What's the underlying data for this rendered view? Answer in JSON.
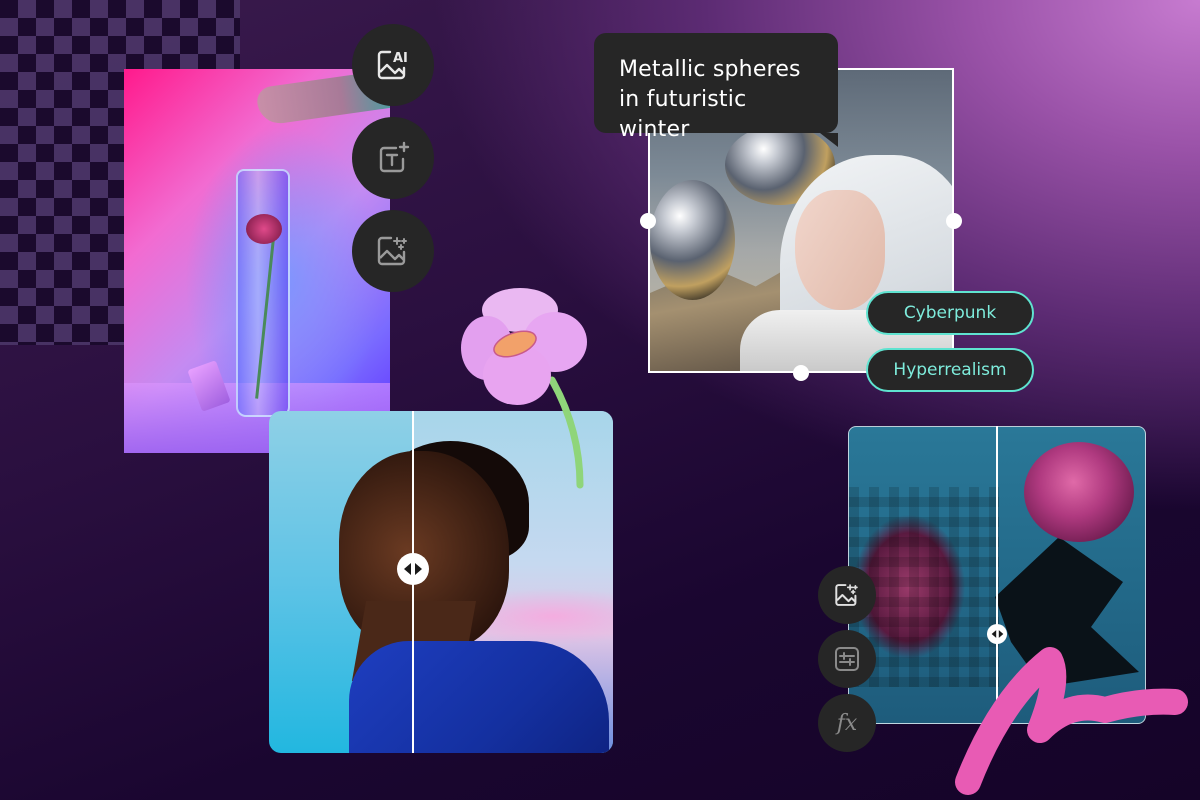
{
  "canvas": {
    "background_accent": "#c77bd0",
    "background_dark": "#150428",
    "transparency_grid": "checkerboard"
  },
  "vase_card": {
    "subject": "flower in glass vase with neon lighting",
    "tools": [
      {
        "name": "ai-image",
        "icon": "image-ai-icon",
        "label": "AI"
      },
      {
        "name": "add-text",
        "icon": "text-plus-icon",
        "label": "T"
      },
      {
        "name": "magic-image",
        "icon": "image-sparkle-icon"
      }
    ]
  },
  "portrait_card": {
    "subject": "man looking upward, background replaced",
    "compare_slider": {
      "position": 0.42,
      "icon": "left-right-arrows-icon"
    }
  },
  "ai_generation_card": {
    "prompt": {
      "line1": "Metallic spheres",
      "line2": "in futuristic winter"
    },
    "style_chips": [
      {
        "label": "Cyberpunk"
      },
      {
        "label": "Hyperrealism"
      }
    ],
    "chip_color": "#5fe3d0"
  },
  "peony_card": {
    "subject": "pink peony, pixelated vs enhanced",
    "compare_slider": {
      "position": 0.5,
      "icon": "left-right-arrows-icon"
    },
    "tools": [
      {
        "name": "magic-image",
        "icon": "image-sparkle-icon"
      },
      {
        "name": "adjustments",
        "icon": "sliders-icon"
      },
      {
        "name": "effects",
        "icon": "fx-icon",
        "label": "fx"
      }
    ]
  },
  "decorations": {
    "squiggle_color": "#e85bb4",
    "flower_petal_color": "#e7a6f2",
    "flower_center_color": "#f2a16a",
    "flower_stem_color": "#8fd57a"
  }
}
